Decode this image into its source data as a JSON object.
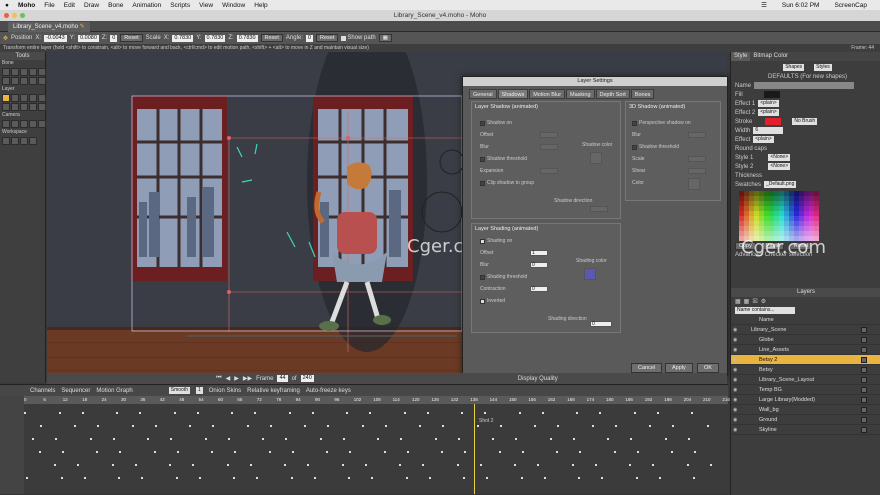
{
  "menubar": {
    "items": [
      "Moho",
      "File",
      "Edit",
      "Draw",
      "Bone",
      "Animation",
      "Scripts",
      "View",
      "Window",
      "Help"
    ],
    "clock": "Sun 6:02 PM",
    "recorder": "ScreenCap"
  },
  "window": {
    "title": "Library_Scene_v4.moho - Moho",
    "tab": "Library_Scene_v4.moho"
  },
  "tool_options": {
    "position_label": "Position",
    "x_label": "X:",
    "x_value": "-0.0043",
    "y_label": "Y:",
    "y_value": "0.0080",
    "z_label": "Z:",
    "z_value": "0",
    "reset": "Reset",
    "scale_label": "Scale",
    "sx_value": "0.7830",
    "sy_value": "0.7830",
    "sz_value": "0.7830",
    "angle_label": "Angle:",
    "angle_value": "0",
    "show_path": "Show path"
  },
  "hint": "Transform entire layer (hold <shift> to constrain, <alt> to move forward and back, <ctrl/cmd> to edit motion path, <shift> + <alt> to move in Z and maintain visual size)",
  "frame_label": "Frame: 44",
  "tools": {
    "title": "Tools",
    "sections": [
      "Bone",
      "Layer",
      "Camera",
      "Workspace"
    ]
  },
  "playback": {
    "frame_label": "Frame",
    "frame": "44",
    "of": "of",
    "total": "240",
    "display_quality": "Display Quality"
  },
  "timeline": {
    "tabs": [
      "Channels",
      "Sequencer",
      "Motion Graph"
    ],
    "interp": "Smooth",
    "interp_n": "1",
    "onion": "Onion Skins",
    "relative": "Relative keyframing",
    "autofreeze": "Auto-freeze keys",
    "marker": "Shot 2",
    "ruler": [
      "0",
      "6",
      "12",
      "18",
      "24",
      "30",
      "36",
      "42",
      "48",
      "54",
      "60",
      "66",
      "72",
      "78",
      "84",
      "90",
      "96",
      "102",
      "108",
      "114",
      "120",
      "126",
      "132",
      "138",
      "144",
      "150",
      "156",
      "162",
      "168",
      "174",
      "180",
      "186",
      "192",
      "198",
      "204",
      "210",
      "216"
    ]
  },
  "dialog": {
    "title": "Layer Settings",
    "tabs": [
      "General",
      "Shadows",
      "Motion Blur",
      "Masking",
      "Depth Sort",
      "Bones"
    ],
    "shadow": {
      "title": "Layer Shadow (animated)",
      "shadow_on": "Shadow on",
      "offset": "Offset",
      "blur": "Blur",
      "threshold": "Shadow threshold",
      "expansion": "Expansion",
      "clip": "Clip shadow to group",
      "color": "Shadow color",
      "direction": "Shadow direction"
    },
    "shadow3d": {
      "title": "3D Shadow (animated)",
      "persp": "Perspective shadow on",
      "blur": "Blur",
      "threshold": "Shadow threshold",
      "scale": "Scale",
      "shear": "Shear",
      "color": "Color"
    },
    "shading": {
      "title": "Layer Shading (animated)",
      "shading_on": "Shading on",
      "offset": "Offset",
      "offset_value": "1",
      "blur": "Blur",
      "blur_value": "0",
      "threshold": "Shading threshold",
      "contraction": "Contraction",
      "contraction_value": "0",
      "inverted": "Inverted",
      "color": "Shading color",
      "direction": "Shading direction",
      "direction_value": "0"
    },
    "cancel": "Cancel",
    "apply": "Apply",
    "ok": "OK"
  },
  "style_panel": {
    "tabs": [
      "Style",
      "Bitmap Color"
    ],
    "shapes": "Shapes",
    "styles": "Styles",
    "defaults": "DEFAULTS (For new shapes)",
    "name": "Name",
    "fill": "Fill",
    "effect1": "Effect 1",
    "effect2": "Effect 2",
    "plain": "<plain>",
    "stroke": "Stroke",
    "width": "Width",
    "width_value": "6",
    "effect": "Effect",
    "no_brush": "No Brush",
    "round_caps": "Round caps",
    "style1": "Style 1",
    "style2": "Style 2",
    "none": "<None>",
    "thickness": "Thickness",
    "swatches": "Swatches",
    "swatch_file": "_Default.png",
    "copy": "Copy",
    "paste": "Paste",
    "reset": "Reset",
    "advanced": "Advanced",
    "checker": "Checker selection",
    "colors": {
      "fill": "#1a1a1a",
      "stroke": "#e0202a"
    }
  },
  "layers_panel": {
    "title": "Layers",
    "name_col": "Name",
    "filter": "Name contains...",
    "rows": [
      "Library_Scene",
      "Globe",
      "Line_Assets",
      "Betsy 2",
      "Betsy",
      "Library_Scene_Layout",
      "Temp BG",
      "Large Library(Modded)",
      "Wall_bg",
      "Ground",
      "Skyline"
    ]
  },
  "watermark": "Cger.com"
}
